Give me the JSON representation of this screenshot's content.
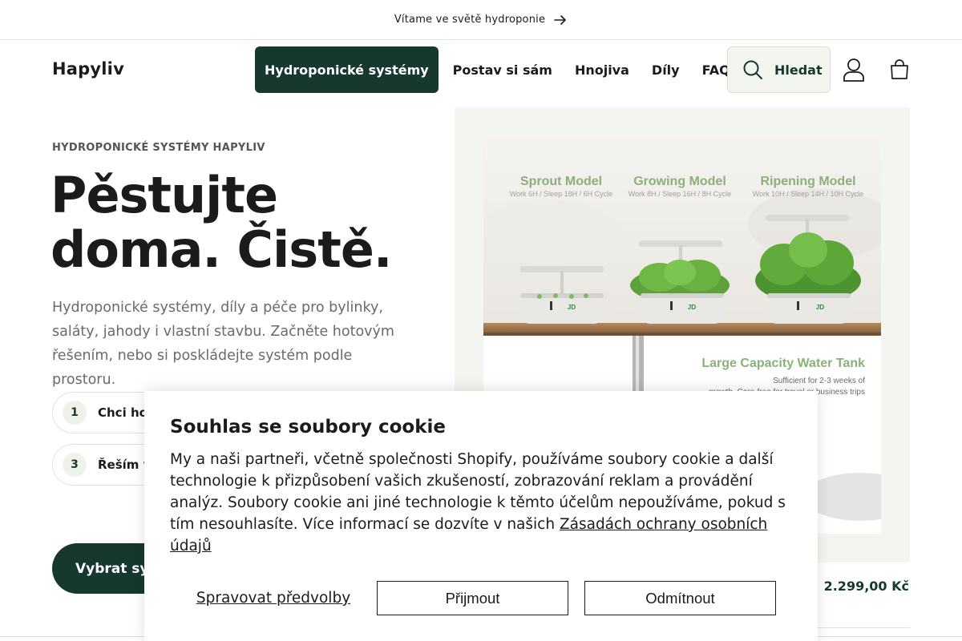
{
  "announcement": {
    "text": "Vítame ve světě hydroponie"
  },
  "header": {
    "logo": "Hapyliv",
    "nav": [
      {
        "label": "Hydroponické systémy",
        "active": true
      },
      {
        "label": "Postav si sám",
        "active": false
      },
      {
        "label": "Hnojiva",
        "active": false
      },
      {
        "label": "Díly",
        "active": false
      },
      {
        "label": "FAQ",
        "active": false
      }
    ],
    "search_label": "Hledat"
  },
  "hero": {
    "eyebrow": "HYDROPONICKÉ SYSTÉMY HAPYLIV",
    "headline_line1": "Pěstujte",
    "headline_line2": "doma. Čistě.",
    "lead": "Hydroponické systémy, díly a péče pro bylinky, saláty, jahody i vlastní stavbu. Začněte hotovým řešením, nebo si poskládejte systém podle prostoru.",
    "steps": [
      {
        "num": "1",
        "label": "Chci hot"
      },
      {
        "num": "3",
        "label": "Řeším v"
      }
    ],
    "cta": "Vybrat sys"
  },
  "product_image": {
    "models": [
      {
        "name": "Sprout Model",
        "desc": "Work 6H / Sleep 18H / 6H Cycle"
      },
      {
        "name": "Growing Model",
        "desc": "Work 8H / Sleep 16H / 8H Cycle"
      },
      {
        "name": "Ripening Model",
        "desc": "Work 10H / Sleep 14H / 10H Cycle"
      }
    ],
    "tank_title": "Large Capacity Water Tank",
    "tank_desc_1": "Sufficient for 2-3 weeks of",
    "tank_desc_2": "growth. Care-free for travel or business trips",
    "brand": "JD"
  },
  "price": "2.299,00 Kč",
  "cookie": {
    "title": "Souhlas se soubory cookie",
    "body": "My a naši partneři, včetně společnosti Shopify, používáme soubory cookie a další technologie k přizpůsobení vašich zkušeností, zobrazování reklam a provádění analýz. Soubory cookie ani jiné technologie k těmto účelům nepoužíváme, pokud s tím nesouhlasíte. Více informací se dozvíte v našich ",
    "link": "Zásadách ochrany osobních údajů",
    "manage": "Spravovat předvolby",
    "accept": "Přijmout",
    "decline": "Odmítnout"
  },
  "colors": {
    "brand": "#17382e",
    "panel": "#f3f6f0",
    "search_bg": "#f2f6ef"
  }
}
